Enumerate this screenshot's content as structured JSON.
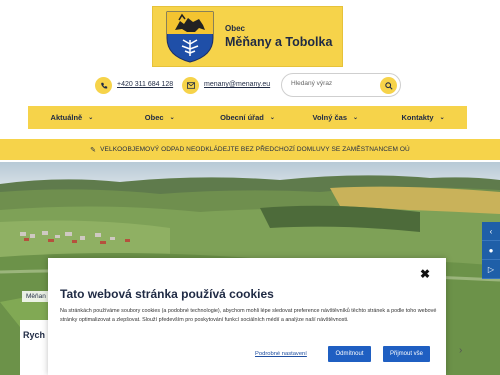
{
  "header": {
    "small_label": "Obec",
    "title": "Měňany a Tobolka"
  },
  "contacts": {
    "phone": "+420 311 684 128",
    "email": "menany@menany.eu"
  },
  "search": {
    "placeholder": "Hledaný výraz"
  },
  "nav": {
    "items": [
      {
        "label": "Aktuálně"
      },
      {
        "label": "Obec"
      },
      {
        "label": "Obecní úřad"
      },
      {
        "label": "Volný čas"
      },
      {
        "label": "Kontakty"
      }
    ]
  },
  "banner": {
    "text": "VELKOOBJEMOVÝ ODPAD NEODKLÁDEJTE BEZ PŘEDCHOZÍ DOMLUVY SE ZAMĚSTNANCEM OÚ"
  },
  "hero": {
    "label": "Měňan",
    "card_title": "Rych"
  },
  "cookie": {
    "title": "Tato webová stránka používá cookies",
    "text": "Na stránkách používáme soubory cookies (a podobné technologie), abychom mohli lépe sledovat preference návštěvníků těchto stránek a podle toho webové stránky optimalizovat a zlepšovat. Slouží především pro poskytování funkcí sociálních médií a analýze naší návštěvnosti.",
    "settings_label": "Podrobné nastavení",
    "reject_label": "Odmítnout",
    "accept_label": "Přijmout vše"
  },
  "colors": {
    "brand_yellow": "#f6d34a",
    "brand_navy": "#1f2a44",
    "button_blue": "#1f5fc2"
  },
  "icons": {
    "phone": "phone-icon",
    "email": "email-icon",
    "search": "search-icon",
    "close": "close-icon",
    "chevron": "chevron-down-icon"
  }
}
